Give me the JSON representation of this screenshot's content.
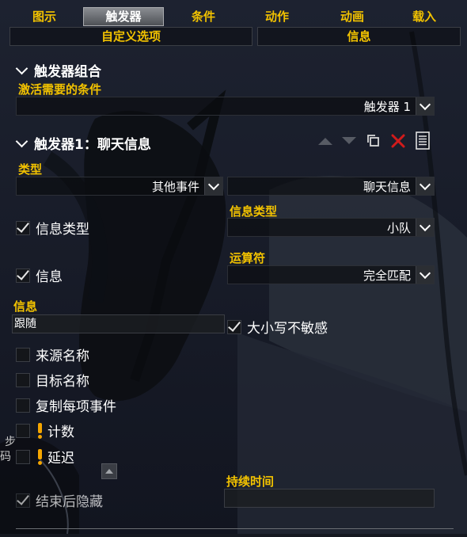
{
  "tabs": [
    {
      "label": "图示",
      "active": false
    },
    {
      "label": "触发器",
      "active": true
    },
    {
      "label": "条件",
      "active": false
    },
    {
      "label": "动作",
      "active": false
    },
    {
      "label": "动画",
      "active": false
    },
    {
      "label": "载入",
      "active": false
    }
  ],
  "subtabs": [
    {
      "label": "自定义选项"
    },
    {
      "label": "信息"
    }
  ],
  "trigger_group": {
    "title": "触发器组合",
    "activation_label": "激活需要的条件",
    "activation_value": "触发器 1"
  },
  "trigger1": {
    "title": "触发器1：聊天信息",
    "type_label": "类型",
    "type_value": "其他事件",
    "subtype_value": "聊天信息",
    "message_type": {
      "checkbox_label": "信息类型",
      "checked": true,
      "field_label": "信息类型",
      "value": "小队"
    },
    "message": {
      "checkbox_label": "信息",
      "checked": true,
      "operator_label": "运算符",
      "operator_value": "完全匹配"
    },
    "message_field": {
      "label": "信息",
      "value": "跟随"
    },
    "case_insensitive": {
      "label": "大小写不敏感",
      "checked": true
    },
    "source_name": {
      "label": "来源名称",
      "checked": false
    },
    "target_name": {
      "label": "目标名称",
      "checked": false
    },
    "clone_per_event": {
      "label": "复制每项事件",
      "checked": false
    },
    "count": {
      "label": "计数",
      "checked": false
    },
    "delay": {
      "label": "延迟",
      "checked": false
    },
    "hide_on_end": {
      "label": "结束后隐藏",
      "checked": true
    },
    "duration": {
      "label": "持续时间",
      "value": ""
    }
  },
  "background_text": {
    "left1": "步",
    "left2": "码"
  },
  "colors": {
    "accent": "#f2c200",
    "delete": "#d11b1b",
    "warning": "#f5a600"
  },
  "icons": [
    "chevron-down-icon",
    "arrow-up-icon",
    "arrow-down-icon",
    "duplicate-icon",
    "delete-icon",
    "document-icon",
    "warning-icon",
    "checkmark-icon"
  ]
}
